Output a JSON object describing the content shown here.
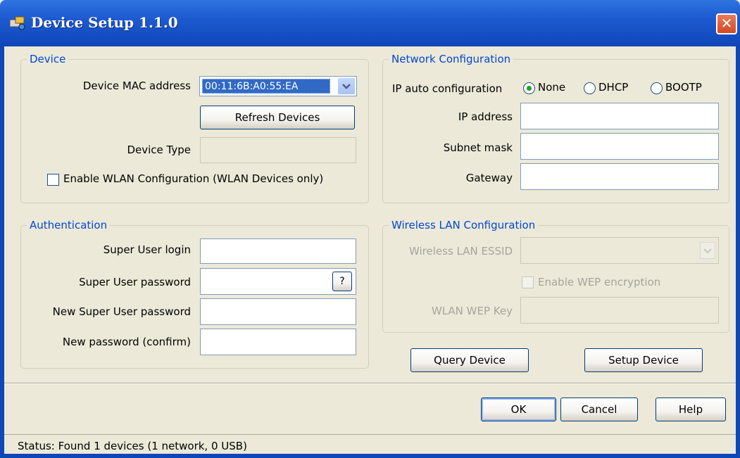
{
  "window": {
    "title": "Device Setup 1.1.0",
    "close_label": "✕"
  },
  "device": {
    "legend": "Device",
    "mac_label": "Device MAC address",
    "mac_value": "00:11:6B:A0:55:EA",
    "refresh_label": "Refresh Devices",
    "type_label": "Device Type",
    "type_value": "",
    "wlan_enable_label": "Enable WLAN Configuration (WLAN Devices only)",
    "wlan_enable_checked": false
  },
  "network": {
    "legend": "Network Configuration",
    "ip_auto_label": "IP auto configuration",
    "ip_auto_options": [
      "None",
      "DHCP",
      "BOOTP"
    ],
    "ip_auto_selected": "None",
    "ip_label": "IP address",
    "ip_value": "",
    "subnet_label": "Subnet mask",
    "subnet_value": "",
    "gateway_label": "Gateway",
    "gateway_value": ""
  },
  "auth": {
    "legend": "Authentication",
    "login_label": "Super User login",
    "password_label": "Super User password",
    "help_label": "?",
    "new_password_label": "New Super User password",
    "confirm_label": "New password (confirm)"
  },
  "wireless": {
    "legend": "Wireless LAN Configuration",
    "essid_label": "Wireless LAN ESSID",
    "essid_value": "",
    "wep_enable_label": "Enable WEP encryption",
    "wep_key_label": "WLAN WEP Key",
    "wep_key_value": ""
  },
  "actions": {
    "query_label": "Query Device",
    "setup_label": "Setup Device"
  },
  "footer": {
    "ok_label": "OK",
    "cancel_label": "Cancel",
    "help_label": "Help"
  },
  "status": {
    "text": "Status: Found 1 devices (1 network, 0 USB)"
  },
  "colors": {
    "accent": "#0046d5",
    "titlebar": "#1d5ad0",
    "selection": "#316ac5",
    "background": "#ece9d8"
  }
}
